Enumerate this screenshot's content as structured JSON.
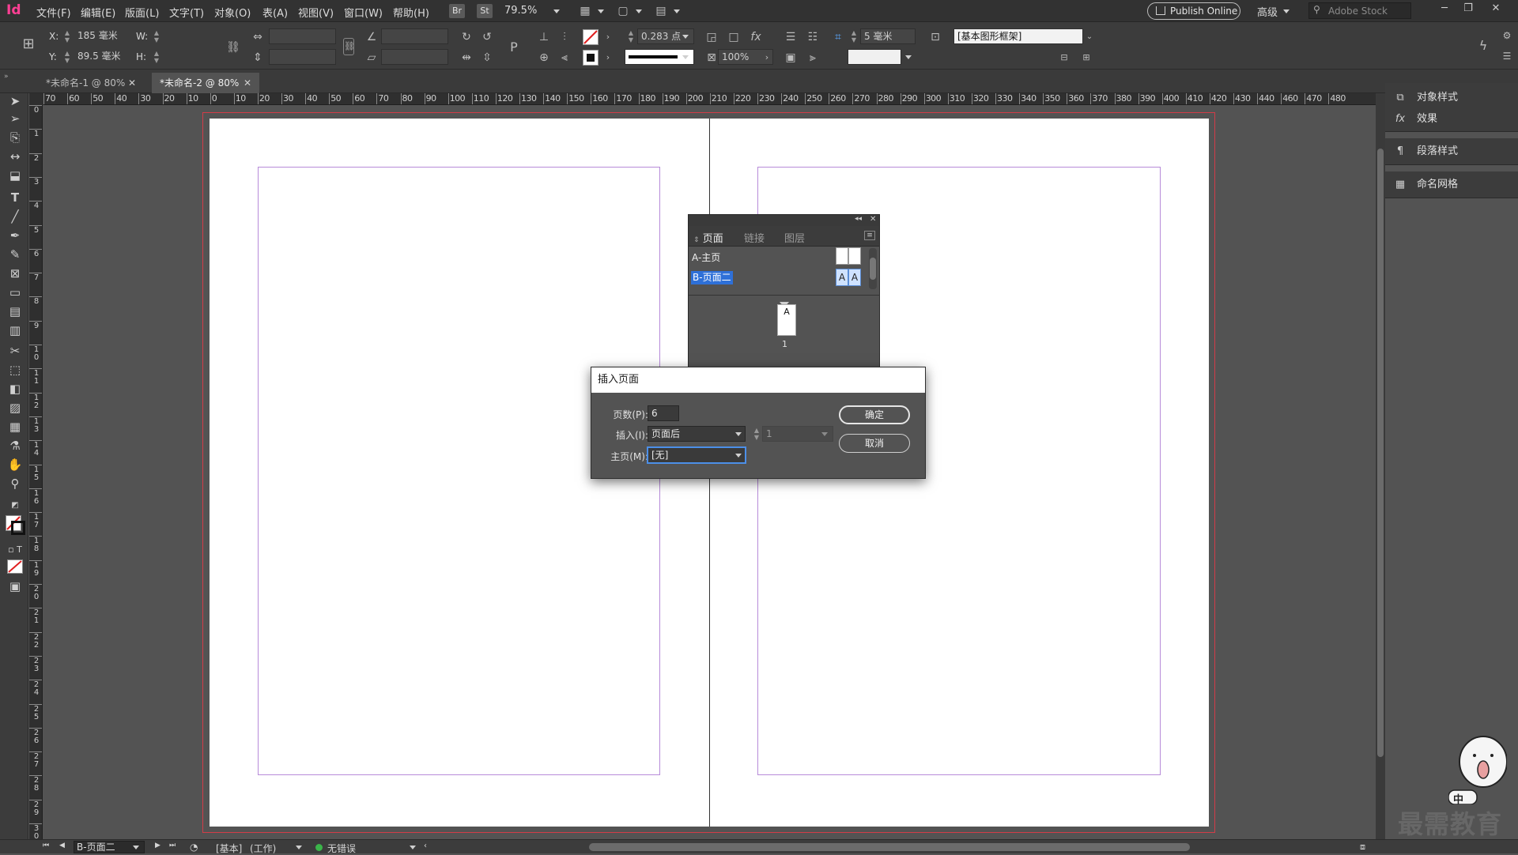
{
  "app": {
    "logo": "Id"
  },
  "menu": {
    "items": [
      "文件(F)",
      "编辑(E)",
      "版面(L)",
      "文字(T)",
      "对象(O)",
      "表(A)",
      "视图(V)",
      "窗口(W)",
      "帮助(H)"
    ],
    "bridge": "Br",
    "stock_badge": "St",
    "zoom": "79.5%",
    "publish": "Publish Online",
    "workspace": "高级",
    "search_placeholder": "Adobe Stock"
  },
  "control": {
    "x_label": "X:",
    "x_value": "185 毫米",
    "y_label": "Y:",
    "y_value": "89.5 毫米",
    "w_label": "W:",
    "h_label": "H:",
    "stroke_weight": "0.283 点",
    "scale": "100%",
    "offset": "5 毫米",
    "object_style": "[基本图形框架]"
  },
  "tabs": [
    {
      "label": "*未命名-1 @ 80%",
      "active": false
    },
    {
      "label": "*未命名-2 @ 80%",
      "active": true
    }
  ],
  "ruler": {
    "h": [
      "70",
      "60",
      "50",
      "40",
      "30",
      "20",
      "10",
      "0",
      "10",
      "20",
      "30",
      "40",
      "50",
      "60",
      "70",
      "80",
      "90",
      "100",
      "110",
      "120",
      "130",
      "140",
      "150",
      "160",
      "170",
      "180",
      "190",
      "200",
      "210",
      "220",
      "230",
      "240",
      "250",
      "260",
      "270",
      "280",
      "290",
      "300",
      "310",
      "320",
      "330",
      "340",
      "350",
      "360",
      "370",
      "380",
      "390",
      "400",
      "410",
      "420",
      "430",
      "440",
      "460",
      "470",
      "480"
    ],
    "v": [
      "0",
      "1",
      "2",
      "3",
      "4",
      "5",
      "6",
      "7",
      "8",
      "9",
      "10",
      "11",
      "12",
      "13",
      "14",
      "15",
      "16",
      "17",
      "18",
      "19",
      "20",
      "21",
      "22",
      "23",
      "24",
      "25",
      "26",
      "27",
      "28",
      "29",
      "30"
    ]
  },
  "pages_panel": {
    "tabs": [
      "页面",
      "链接",
      "图层"
    ],
    "masters": [
      {
        "name": "A-主页",
        "selected": false
      },
      {
        "name": "B-页面二",
        "selected": true
      }
    ],
    "page_thumb_label": "A",
    "page_number": "1",
    "master_letter_a": "A",
    "master_letter_b": "A"
  },
  "dialog": {
    "title": "插入页面",
    "pages_label": "页数(P):",
    "pages_value": "6",
    "insert_label": "插入(I):",
    "insert_value": "页面后",
    "insert_page": "1",
    "master_label": "主页(M):",
    "master_value": "[无]",
    "ok": "确定",
    "cancel": "取消"
  },
  "right_panel": {
    "items": [
      "对象样式",
      "效果",
      "段落样式",
      "命名网格"
    ]
  },
  "status": {
    "page": "B-页面二",
    "style": "[基本]",
    "mode": "(工作)",
    "preflight": "无错误"
  },
  "watermark": "最需教育",
  "mascot_text": "中"
}
